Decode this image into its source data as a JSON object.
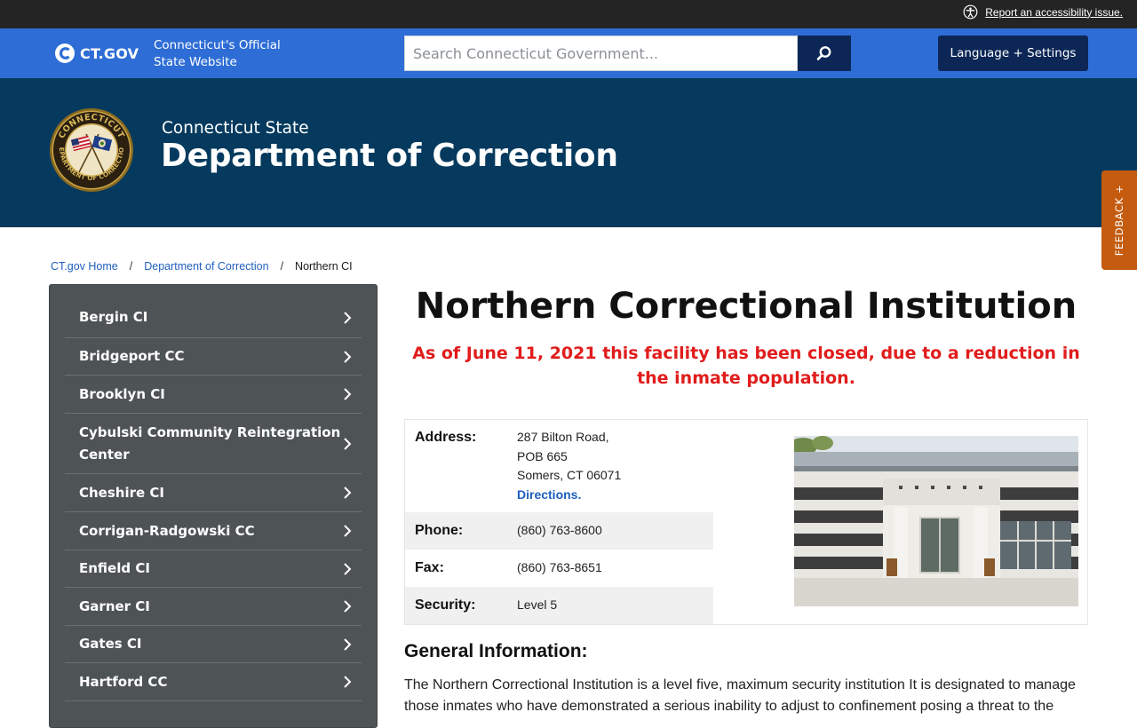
{
  "topbar": {
    "accessibility_link": "Report an accessibility issue."
  },
  "ctbar": {
    "logo_text": "CT.GOV",
    "official_text": "Connecticut's Official State Website",
    "search_placeholder": "Search Connecticut Government...",
    "language_button": "Language + Settings"
  },
  "banner": {
    "subtitle": "Connecticut State",
    "title": "Department of Correction",
    "seal_text": "CONNECTICUT DEPARTMENT OF CORRECTION"
  },
  "feedback": {
    "label": "FEEDBACK +"
  },
  "breadcrumb": {
    "items": [
      "CT.gov Home",
      "Department of Correction"
    ],
    "separator": "/",
    "current": "Northern CI"
  },
  "sidebar": {
    "items": [
      {
        "label": "Bergin CI"
      },
      {
        "label": "Bridgeport CC"
      },
      {
        "label": "Brooklyn CI"
      },
      {
        "label": "Cybulski Community Reintegration Center"
      },
      {
        "label": "Cheshire CI"
      },
      {
        "label": "Corrigan-Radgowski CC"
      },
      {
        "label": "Enfield CI"
      },
      {
        "label": "Garner CI"
      },
      {
        "label": "Gates CI"
      },
      {
        "label": "Hartford CC"
      }
    ]
  },
  "main": {
    "title": "Northern Correctional Institution",
    "closure_notice": "As of June 11, 2021 this facility has been closed, due to a reduction in the inmate population.",
    "info": {
      "address_label": "Address:",
      "address_line1": "287 Bilton Road,",
      "address_line2": "POB 665",
      "address_line3": "Somers, CT 06071",
      "directions": "Directions.",
      "phone_label": "Phone:",
      "phone": "(860) 763-8600",
      "fax_label": "Fax:",
      "fax": "(860) 763-8651",
      "security_label": "Security:",
      "security": "Level 5"
    },
    "general_heading": "General Information:",
    "general_text": "The Northern Correctional Institution is a level five, maximum security institution  It is designated to manage those inmates who have demonstrated a serious inability to adjust to confinement posing a threat to the"
  },
  "colors": {
    "topbar": "#242424",
    "ctbar": "#2e6dd6",
    "navy": "#0c2756",
    "banner": "#053a5e",
    "feedback": "#c45b0f",
    "sidebar": "#4e5356",
    "closure_red": "#e11c1c",
    "link": "#1f5fbf"
  }
}
